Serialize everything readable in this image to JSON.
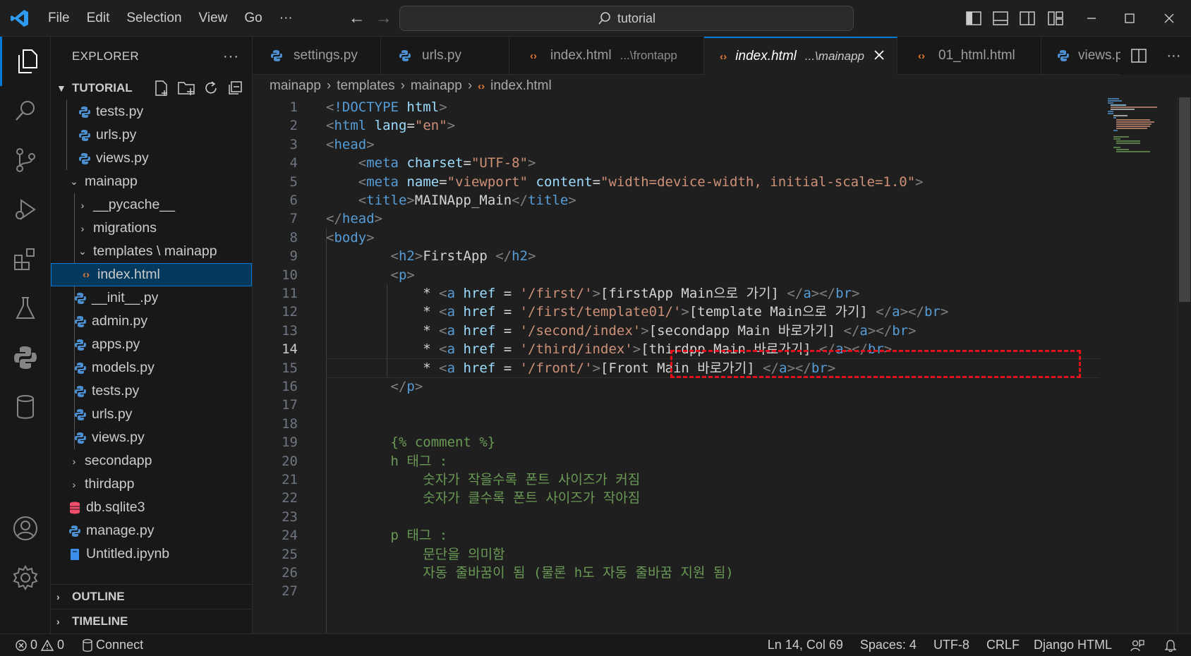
{
  "titlebar": {
    "menu": [
      "File",
      "Edit",
      "Selection",
      "View",
      "Go"
    ],
    "more": "···",
    "search_text": "tutorial"
  },
  "sidebar": {
    "title": "EXPLORER",
    "more": "···",
    "root_label": "TUTORIAL",
    "outline_label": "OUTLINE",
    "timeline_label": "TIMELINE",
    "tree": [
      {
        "label": "tests.py",
        "icon": "python-icon"
      },
      {
        "label": "urls.py",
        "icon": "python-icon"
      },
      {
        "label": "views.py",
        "icon": "python-icon"
      },
      {
        "label": "mainapp",
        "icon": "folder-open"
      },
      {
        "label": "__pycache__",
        "icon": "folder-closed"
      },
      {
        "label": "migrations",
        "icon": "folder-closed"
      },
      {
        "label": "templates \\ mainapp",
        "icon": "folder-open"
      },
      {
        "label": "index.html",
        "icon": "html-icon",
        "selected": true
      },
      {
        "label": "__init__.py",
        "icon": "python-icon"
      },
      {
        "label": "admin.py",
        "icon": "python-icon"
      },
      {
        "label": "apps.py",
        "icon": "python-icon"
      },
      {
        "label": "models.py",
        "icon": "python-icon"
      },
      {
        "label": "tests.py",
        "icon": "python-icon"
      },
      {
        "label": "urls.py",
        "icon": "python-icon"
      },
      {
        "label": "views.py",
        "icon": "python-icon"
      },
      {
        "label": "secondapp",
        "icon": "folder-closed"
      },
      {
        "label": "thirdapp",
        "icon": "folder-closed"
      },
      {
        "label": "db.sqlite3",
        "icon": "database-icon"
      },
      {
        "label": "manage.py",
        "icon": "python-icon"
      },
      {
        "label": "Untitled.ipynb",
        "icon": "notebook-icon"
      }
    ]
  },
  "tabs": [
    {
      "label": "settings.py",
      "desc": "",
      "icon": "python-icon"
    },
    {
      "label": "urls.py",
      "desc": "",
      "icon": "python-icon"
    },
    {
      "label": "index.html",
      "desc": "...\\frontapp",
      "icon": "html-icon"
    },
    {
      "label": "index.html",
      "desc": "...\\mainapp",
      "icon": "html-icon",
      "active": true
    },
    {
      "label": "01_html.html",
      "desc": "",
      "icon": "html-icon"
    },
    {
      "label": "views.py",
      "desc": "",
      "icon": "python-icon"
    }
  ],
  "breadcrumb": [
    "mainapp",
    "templates",
    "mainapp",
    "index.html"
  ],
  "editor": {
    "current_line": 14,
    "lines": [
      {
        "n": "1",
        "code": "<!DOCTYPE html>"
      },
      {
        "n": "2",
        "code": "<html lang=\"en\">"
      },
      {
        "n": "3",
        "code": "<head>"
      },
      {
        "n": "4",
        "code": "    <meta charset=\"UTF-8\">"
      },
      {
        "n": "5",
        "code": "    <meta name=\"viewport\" content=\"width=device-width, initial-scale=1.0\">"
      },
      {
        "n": "6",
        "code": "    <title>MAINApp_Main</title>"
      },
      {
        "n": "7",
        "code": "</head>"
      },
      {
        "n": "8",
        "code": "<body>"
      },
      {
        "n": "9",
        "code": "        <h2>FirstApp </h2>"
      },
      {
        "n": "10",
        "code": "        <p>"
      },
      {
        "n": "11",
        "code": "            * <a href = '/first/'>[firstApp Main으로 가기] </a></br>"
      },
      {
        "n": "12",
        "code": "            * <a href = '/first/template01/'>[template Main으로 가기] </a></br>"
      },
      {
        "n": "13",
        "code": "            * <a href = '/second/index'>[secondapp Main 바로가기] </a></br>"
      },
      {
        "n": "14",
        "code": "            * <a href = '/third/index'>[thirdpp Main 바로가기] </a></br>"
      },
      {
        "n": "15",
        "code": "            * <a href = '/front/'>[Front Main 바로가기] </a></br>"
      },
      {
        "n": "16",
        "code": "        </p>"
      },
      {
        "n": "17",
        "code": ""
      },
      {
        "n": "18",
        "code": ""
      },
      {
        "n": "19",
        "code": "        {% comment %}"
      },
      {
        "n": "20",
        "code": "        h 태그 :"
      },
      {
        "n": "21",
        "code": "            숫자가 작을수록 폰트 사이즈가 커짐"
      },
      {
        "n": "22",
        "code": "            숫자가 클수록 폰트 사이즈가 작아짐"
      },
      {
        "n": "23",
        "code": ""
      },
      {
        "n": "24",
        "code": "        p 태그 :"
      },
      {
        "n": "25",
        "code": "            문단을 의미함"
      },
      {
        "n": "26",
        "code": "            자동 줄바꿈이 됨 (물론 h도 자동 줄바꿈 지원 됨)"
      },
      {
        "n": "27",
        "code": ""
      }
    ]
  },
  "statusbar": {
    "errors": "0",
    "warnings": "0",
    "connect": "Connect",
    "position": "Ln 14, Col 69",
    "spaces": "Spaces: 4",
    "encoding": "UTF-8",
    "eol": "CRLF",
    "language": "Django HTML"
  },
  "colors": {
    "accent": "#0078d4",
    "tag": "#569cd6",
    "attribute": "#9cdcfe",
    "string": "#ce9178",
    "comment": "#6a9955",
    "highlight_box": "#e3121a"
  }
}
